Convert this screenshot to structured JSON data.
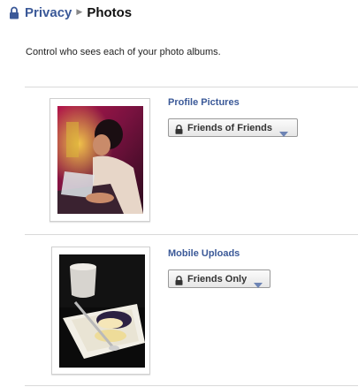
{
  "breadcrumb": {
    "parent": "Privacy",
    "separator": "▶",
    "current": "Photos"
  },
  "intro_text": "Control who sees each of your photo albums.",
  "albums": [
    {
      "title": "Profile Pictures",
      "privacy": "Friends of Friends"
    },
    {
      "title": "Mobile Uploads",
      "privacy": "Friends Only"
    }
  ],
  "icons": {
    "breadcrumb": "lock-icon",
    "privacy_button": "lock-icon",
    "dropdown": "triangle-down-icon"
  },
  "colors": {
    "link": "#3b5998",
    "divider": "#d9d9d9",
    "button_border": "#999999"
  }
}
